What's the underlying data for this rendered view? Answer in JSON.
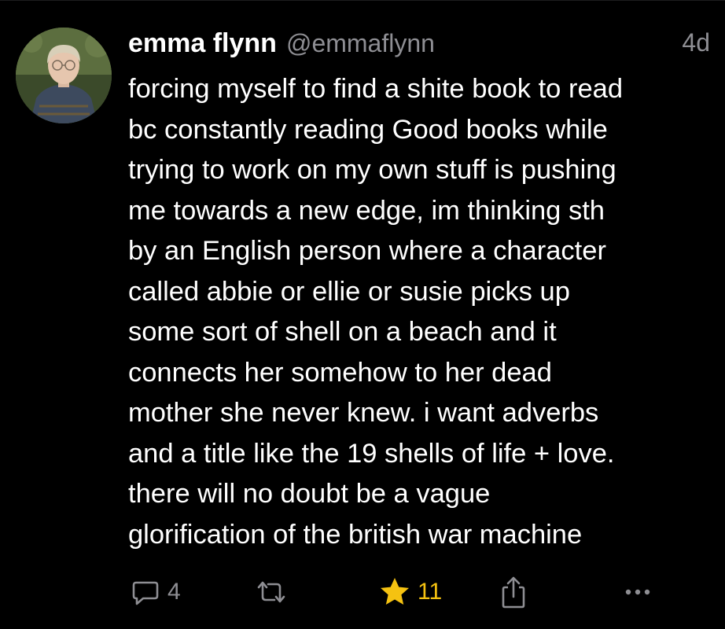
{
  "post": {
    "author": {
      "display_name": "emma flynn",
      "handle": "@emmaflynn"
    },
    "timestamp": "4d",
    "body_lines": [
      "forcing myself to find a shite book to read",
      "bc constantly reading Good books while",
      "trying to work on my own stuff is pushing",
      "me towards a new edge, im thinking sth",
      "by an English person where a character",
      "called abbie or ellie or susie picks up",
      "some sort of shell on a beach and it",
      "connects her somehow to her dead",
      "mother she never knew. i want adverbs",
      "and a title like the 19 shells of life + love.",
      "there will no doubt be a vague",
      "glorification of the british war machine"
    ]
  },
  "actions": {
    "reply": {
      "icon": "reply-bubble-icon",
      "count": "4"
    },
    "repost": {
      "icon": "repost-arrows-icon",
      "count": ""
    },
    "like": {
      "icon": "star-icon",
      "count": "11",
      "active": true,
      "color": "#f5c211"
    },
    "share": {
      "icon": "share-upload-icon"
    },
    "more": {
      "icon": "ellipsis-icon"
    }
  },
  "colors": {
    "background": "#000000",
    "text": "#ffffff",
    "muted": "#8e8e93",
    "like_active": "#f5c211"
  }
}
